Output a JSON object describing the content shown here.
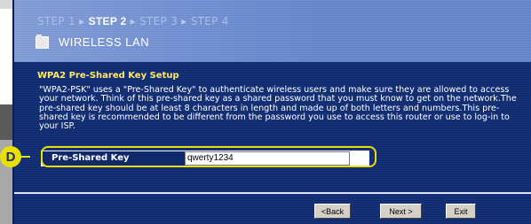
{
  "wizard": {
    "steps": [
      {
        "label": "STEP 1"
      },
      {
        "label": "STEP 2"
      },
      {
        "label": "STEP 3"
      },
      {
        "label": "STEP 4"
      }
    ],
    "active_step": "STEP 2",
    "separator": "▸",
    "title": "WIRELESS LAN",
    "title_icon": "folder-icon"
  },
  "section": {
    "title": "WPA2 Pre-Shared Key Setup",
    "description": "\"WPA2-PSK\" uses a \"Pre-Shared Key\" to authenticate wireless users and make sure they are allowed to access your network. Think of this pre-shared key as a shared password that you must know to get on the network.The pre-shared key should be at least 8 characters in length and made up of both letters and numbers.This pre-shared key is recommended to be different from the password you use to access this router or use to log-in to your ISP."
  },
  "form": {
    "key_label": "Pre-Shared Key",
    "key_value": "qwerty1234"
  },
  "buttons": {
    "back": "<Back",
    "next": "Next >",
    "exit": "Exit"
  },
  "callout": {
    "label": "D"
  },
  "colors": {
    "panel": "#10296a",
    "section_title": "#ffe96a",
    "highlight": "#e8e000"
  }
}
